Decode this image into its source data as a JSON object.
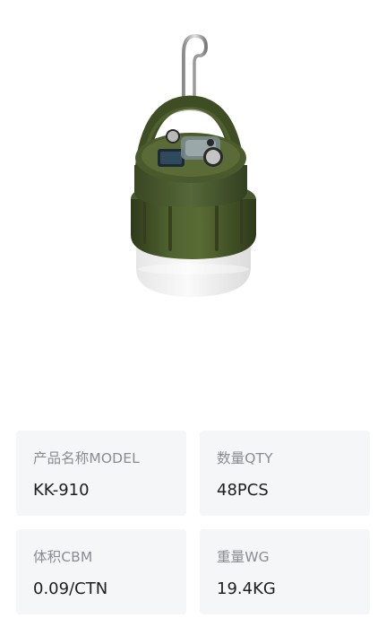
{
  "product": {
    "image_alt": "green camping lantern with hook"
  },
  "specs": [
    {
      "label": "产品名称MODEL",
      "value": "KK-910"
    },
    {
      "label": "数量QTY",
      "value": "48PCS"
    },
    {
      "label": "体积CBM",
      "value": "0.09/CTN"
    },
    {
      "label": "重量WG",
      "value": "19.4KG"
    }
  ],
  "colors": {
    "card_bg": "#f5f6f8",
    "label": "#8a8c92",
    "value": "#1d1e22",
    "lamp_green": "#4a5a2c"
  }
}
